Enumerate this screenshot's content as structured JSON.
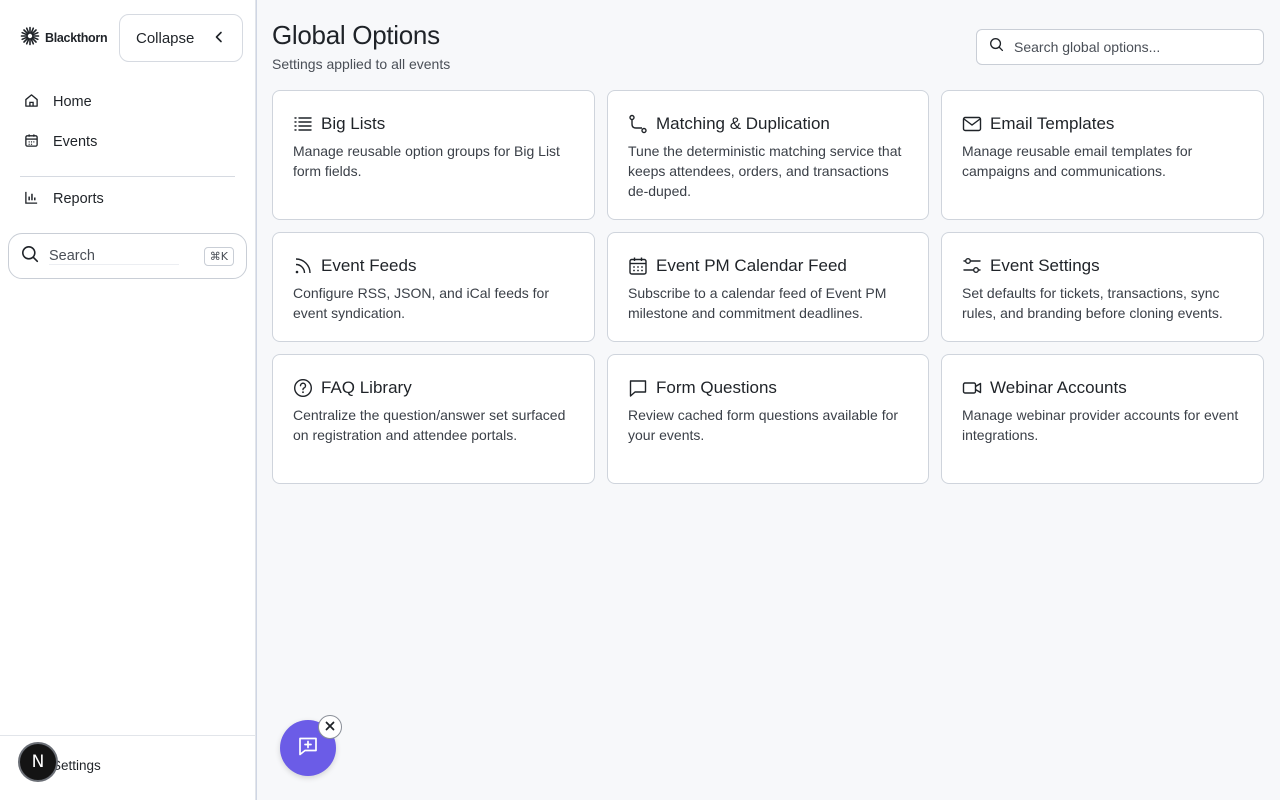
{
  "brand": {
    "name": "Blackthorn"
  },
  "sidebar": {
    "collapse_label": "Collapse",
    "nav": [
      {
        "label": "Home",
        "icon": "home-icon"
      },
      {
        "label": "Events",
        "icon": "calendar-icon"
      },
      {
        "label": "Reports",
        "icon": "bar-chart-icon"
      }
    ],
    "search": {
      "placeholder": "Search",
      "shortcut": "⌘K"
    },
    "settings_label": "Settings",
    "avatar_initial": "N"
  },
  "header": {
    "title": "Global Options",
    "subtitle": "Settings applied to all events",
    "search_placeholder": "Search global options..."
  },
  "cards": [
    {
      "title": "Big Lists",
      "icon": "list-icon",
      "description": "Manage reusable option groups for Big List form fields."
    },
    {
      "title": "Matching & Duplication",
      "icon": "route-icon",
      "description": "Tune the deterministic matching service that keeps attendees, orders, and transactions de-duped."
    },
    {
      "title": "Email Templates",
      "icon": "mail-icon",
      "description": "Manage reusable email templates for campaigns and communications."
    },
    {
      "title": "Event Feeds",
      "icon": "rss-icon",
      "description": "Configure RSS, JSON, and iCal feeds for event syndication."
    },
    {
      "title": "Event PM Calendar Feed",
      "icon": "calendar-grid-icon",
      "description": "Subscribe to a calendar feed of Event PM milestone and commitment deadlines."
    },
    {
      "title": "Event Settings",
      "icon": "sliders-icon",
      "description": "Set defaults for tickets, transactions, sync rules, and branding before cloning events."
    },
    {
      "title": "FAQ Library",
      "icon": "help-circle-icon",
      "description": "Centralize the question/answer set surfaced on registration and attendee portals."
    },
    {
      "title": "Form Questions",
      "icon": "message-square-icon",
      "description": "Review cached form questions available for your events."
    },
    {
      "title": "Webinar Accounts",
      "icon": "video-icon",
      "description": "Manage webinar provider accounts for event integrations."
    }
  ],
  "colors": {
    "accent": "#6b5ce7",
    "border": "#cfd4dc",
    "background": "#f7f8fa"
  }
}
